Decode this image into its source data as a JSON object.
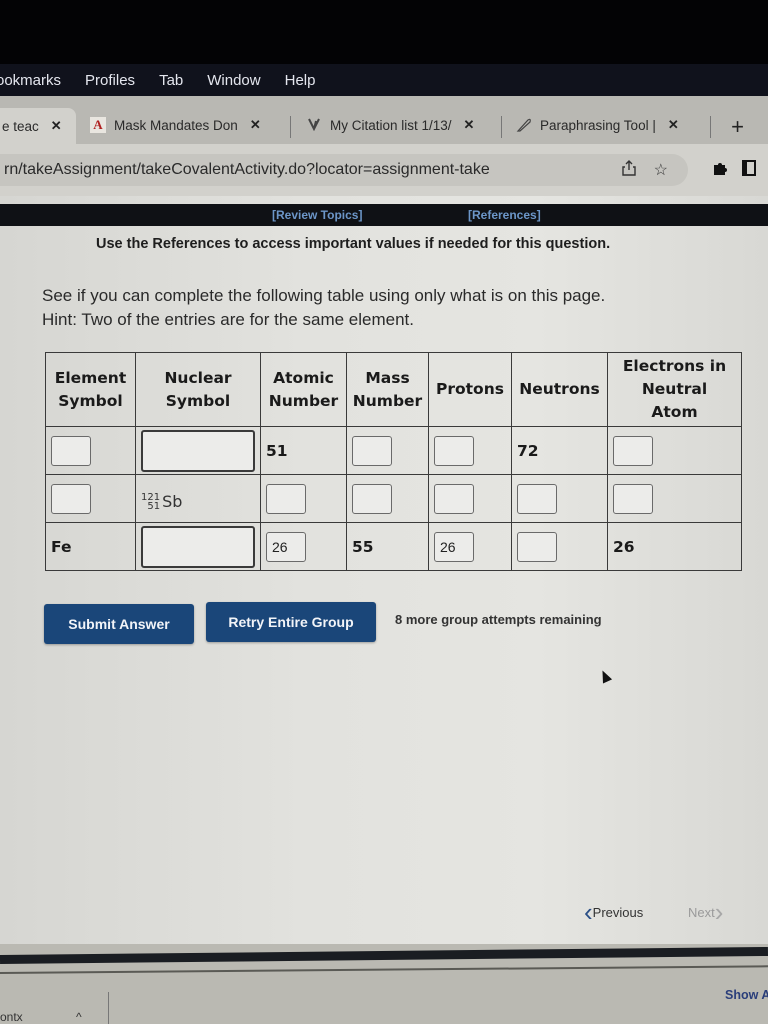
{
  "menubar": {
    "items": [
      "ookmarks",
      "Profiles",
      "Tab",
      "Window",
      "Help"
    ]
  },
  "tabs": [
    {
      "title": "e teac",
      "icon": "tab-favicon",
      "close": "✕",
      "active": true
    },
    {
      "title": "Mask Mandates Don",
      "icon": "A",
      "close": "✕",
      "active": false
    },
    {
      "title": "My Citation list 1/13/",
      "icon": "citation-icon",
      "close": "✕",
      "active": false
    },
    {
      "title": "Paraphrasing Tool |",
      "icon": "quill-icon",
      "close": "✕",
      "active": false
    }
  ],
  "new_tab": "+",
  "address": {
    "url": "rn/takeAssignment/takeCovalentActivity.do?locator=assignment-take"
  },
  "page": {
    "links": {
      "review_topics": "[Review Topics]",
      "references": "[References]"
    },
    "use_note": "Use the References to access important values if needed for this question.",
    "instruction_line1": "See if you can complete the following table using only what is on this page.",
    "instruction_line2": "Hint: Two of the entries are for the same element."
  },
  "table": {
    "headers": {
      "element_symbol": [
        "Element",
        "Symbol"
      ],
      "nuclear_symbol": [
        "Nuclear",
        "Symbol"
      ],
      "atomic_number": [
        "Atomic",
        "Number"
      ],
      "mass_number": [
        "Mass",
        "Number"
      ],
      "protons": "Protons",
      "neutrons": "Neutrons",
      "electrons": [
        "Electrons in",
        "Neutral",
        "Atom"
      ]
    },
    "rows": [
      {
        "element_symbol": {
          "type": "input",
          "value": ""
        },
        "nuclear_symbol": {
          "type": "input",
          "value": ""
        },
        "atomic_number": {
          "type": "text",
          "value": "51"
        },
        "mass_number": {
          "type": "input",
          "value": ""
        },
        "protons": {
          "type": "input",
          "value": ""
        },
        "neutrons": {
          "type": "text",
          "value": "72"
        },
        "electrons": {
          "type": "input",
          "value": ""
        }
      },
      {
        "element_symbol": {
          "type": "input",
          "value": ""
        },
        "nuclear_symbol": {
          "type": "nuclear",
          "mass": "121",
          "atomic": "51",
          "symbol": "Sb"
        },
        "atomic_number": {
          "type": "input",
          "value": ""
        },
        "mass_number": {
          "type": "input",
          "value": ""
        },
        "protons": {
          "type": "input",
          "value": ""
        },
        "neutrons": {
          "type": "input",
          "value": ""
        },
        "electrons": {
          "type": "input",
          "value": ""
        }
      },
      {
        "element_symbol": {
          "type": "text",
          "value": "Fe"
        },
        "nuclear_symbol": {
          "type": "input",
          "value": ""
        },
        "atomic_number": {
          "type": "input",
          "value": "26"
        },
        "mass_number": {
          "type": "text",
          "value": "55"
        },
        "protons": {
          "type": "input",
          "value": "26"
        },
        "neutrons": {
          "type": "input",
          "value": ""
        },
        "electrons": {
          "type": "text",
          "value": "26"
        }
      }
    ]
  },
  "buttons": {
    "submit": "Submit Answer",
    "retry": "Retry Entire Group"
  },
  "attempts_text": "8 more group attempts remaining",
  "pager": {
    "previous": "Previous",
    "next": "Next"
  },
  "downloads": {
    "item": "ontx",
    "show_all": "Show A"
  },
  "colors": {
    "button_bg": "#1a4679",
    "link": "#6c96c8",
    "ref_bar": "#0f1115"
  }
}
